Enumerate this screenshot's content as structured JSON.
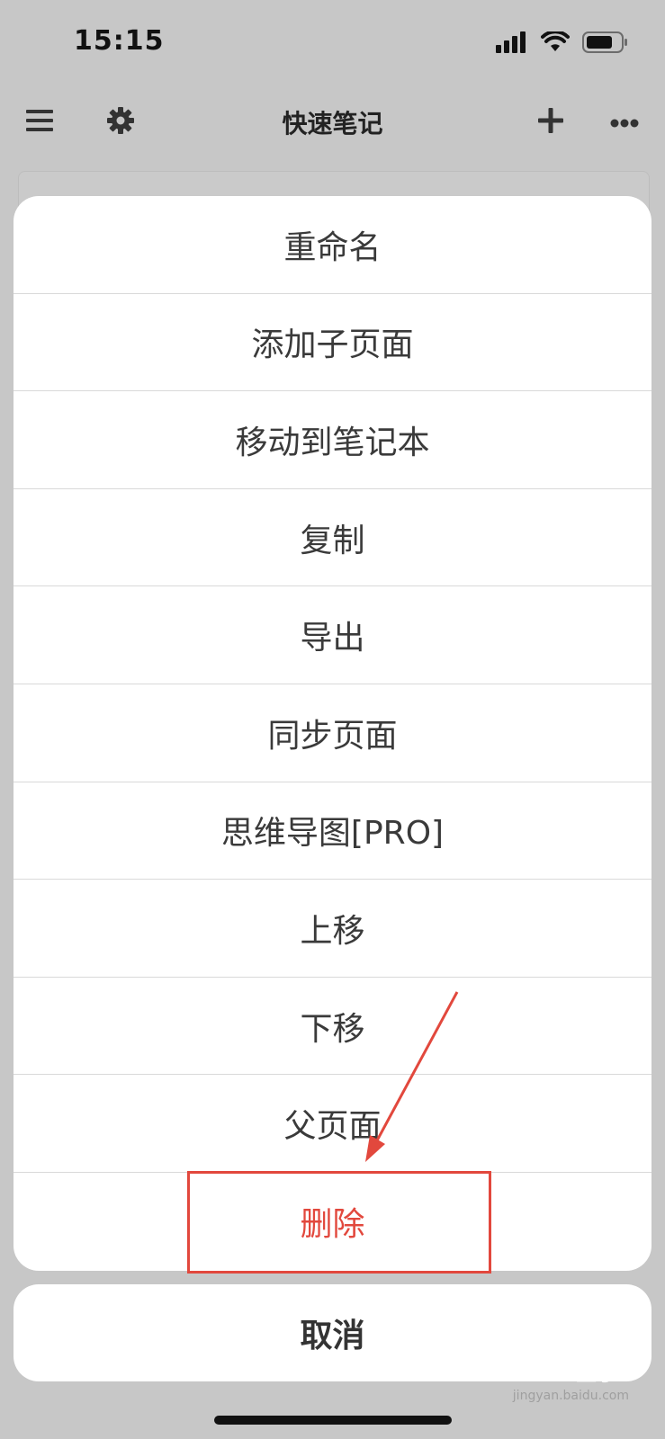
{
  "status_bar": {
    "time": "15:15"
  },
  "nav": {
    "title": "快速笔记"
  },
  "menu": {
    "items": [
      {
        "label": "重命名"
      },
      {
        "label": "添加子页面"
      },
      {
        "label": "移动到笔记本"
      },
      {
        "label": "复制"
      },
      {
        "label": "导出"
      },
      {
        "label": "同步页面"
      },
      {
        "label": "思维导图[PRO]"
      },
      {
        "label": "上移"
      },
      {
        "label": "下移"
      },
      {
        "label": "父页面"
      },
      {
        "label": "删除"
      }
    ],
    "cancel_label": "取消"
  },
  "colors": {
    "danger": "#e2483d",
    "backdrop": "#c7c7c7"
  },
  "watermark": {
    "brand": "Baidu 经验",
    "url": "jingyan.baidu.com"
  }
}
